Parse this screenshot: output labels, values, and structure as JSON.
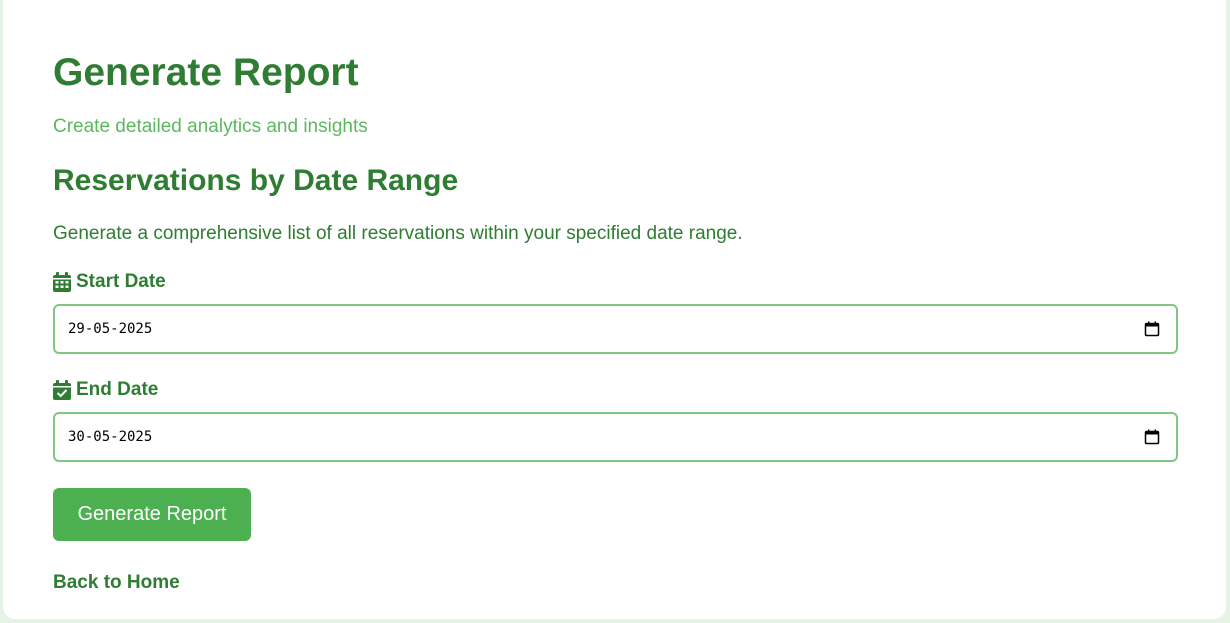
{
  "page": {
    "title": "Generate Report",
    "subtitle": "Create detailed analytics and insights"
  },
  "section": {
    "title": "Reservations by Date Range",
    "description": "Generate a comprehensive list of all reservations within your specified date range."
  },
  "form": {
    "start_label": "Start Date",
    "start_value": "29-05-2025",
    "start_icon": "calendar-icon",
    "end_label": "End Date",
    "end_value": "30-05-2025",
    "end_icon": "calendar-check-icon",
    "submit_label": "Generate Report"
  },
  "nav": {
    "back_label": "Back to Home"
  },
  "colors": {
    "primary_text": "#2e7d32",
    "subtitle_text": "#5cb860",
    "button_bg": "#4caf50",
    "input_border": "#81c784",
    "page_bg": "#e4f3e6"
  }
}
